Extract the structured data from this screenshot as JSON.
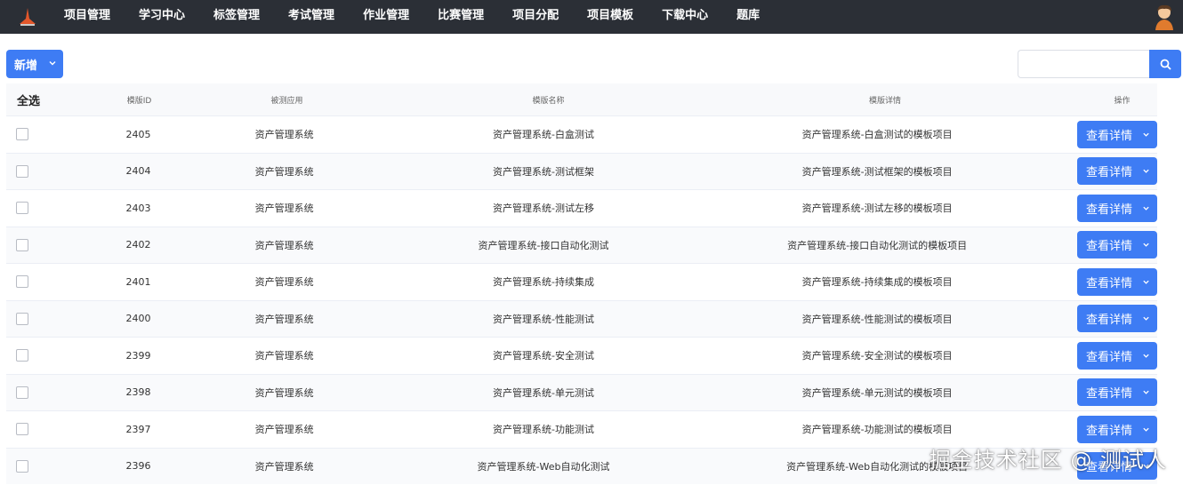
{
  "nav": {
    "items": [
      "项目管理",
      "学习中心",
      "标签管理",
      "考试管理",
      "作业管理",
      "比赛管理",
      "项目分配",
      "项目模板",
      "下载中心",
      "题库"
    ]
  },
  "toolbar": {
    "add_label": "新增",
    "search_placeholder": ""
  },
  "table": {
    "headers": {
      "select_all": "全选",
      "template_id": "模版ID",
      "app": "被测应用",
      "name": "模版名称",
      "detail": "模版详情",
      "ops": "操作"
    },
    "action_label": "查看详情",
    "rows": [
      {
        "id": "2405",
        "app": "资产管理系统",
        "name": "资产管理系统-白盒测试",
        "detail": "资产管理系统-白盒测试的模板项目"
      },
      {
        "id": "2404",
        "app": "资产管理系统",
        "name": "资产管理系统-测试框架",
        "detail": "资产管理系统-测试框架的模板项目"
      },
      {
        "id": "2403",
        "app": "资产管理系统",
        "name": "资产管理系统-测试左移",
        "detail": "资产管理系统-测试左移的模板项目"
      },
      {
        "id": "2402",
        "app": "资产管理系统",
        "name": "资产管理系统-接口自动化测试",
        "detail": "资产管理系统-接口自动化测试的模板项目"
      },
      {
        "id": "2401",
        "app": "资产管理系统",
        "name": "资产管理系统-持续集成",
        "detail": "资产管理系统-持续集成的模板项目"
      },
      {
        "id": "2400",
        "app": "资产管理系统",
        "name": "资产管理系统-性能测试",
        "detail": "资产管理系统-性能测试的模板项目"
      },
      {
        "id": "2399",
        "app": "资产管理系统",
        "name": "资产管理系统-安全测试",
        "detail": "资产管理系统-安全测试的模板项目"
      },
      {
        "id": "2398",
        "app": "资产管理系统",
        "name": "资产管理系统-单元测试",
        "detail": "资产管理系统-单元测试的模板项目"
      },
      {
        "id": "2397",
        "app": "资产管理系统",
        "name": "资产管理系统-功能测试",
        "detail": "资产管理系统-功能测试的模板项目"
      },
      {
        "id": "2396",
        "app": "资产管理系统",
        "name": "资产管理系统-Web自动化测试",
        "detail": "资产管理系统-Web自动化测试的模板项目"
      }
    ]
  },
  "watermark": "掘金技术社区 @ 测试人",
  "colors": {
    "topbar": "#2b2f36",
    "primary": "#3e7cf4"
  }
}
